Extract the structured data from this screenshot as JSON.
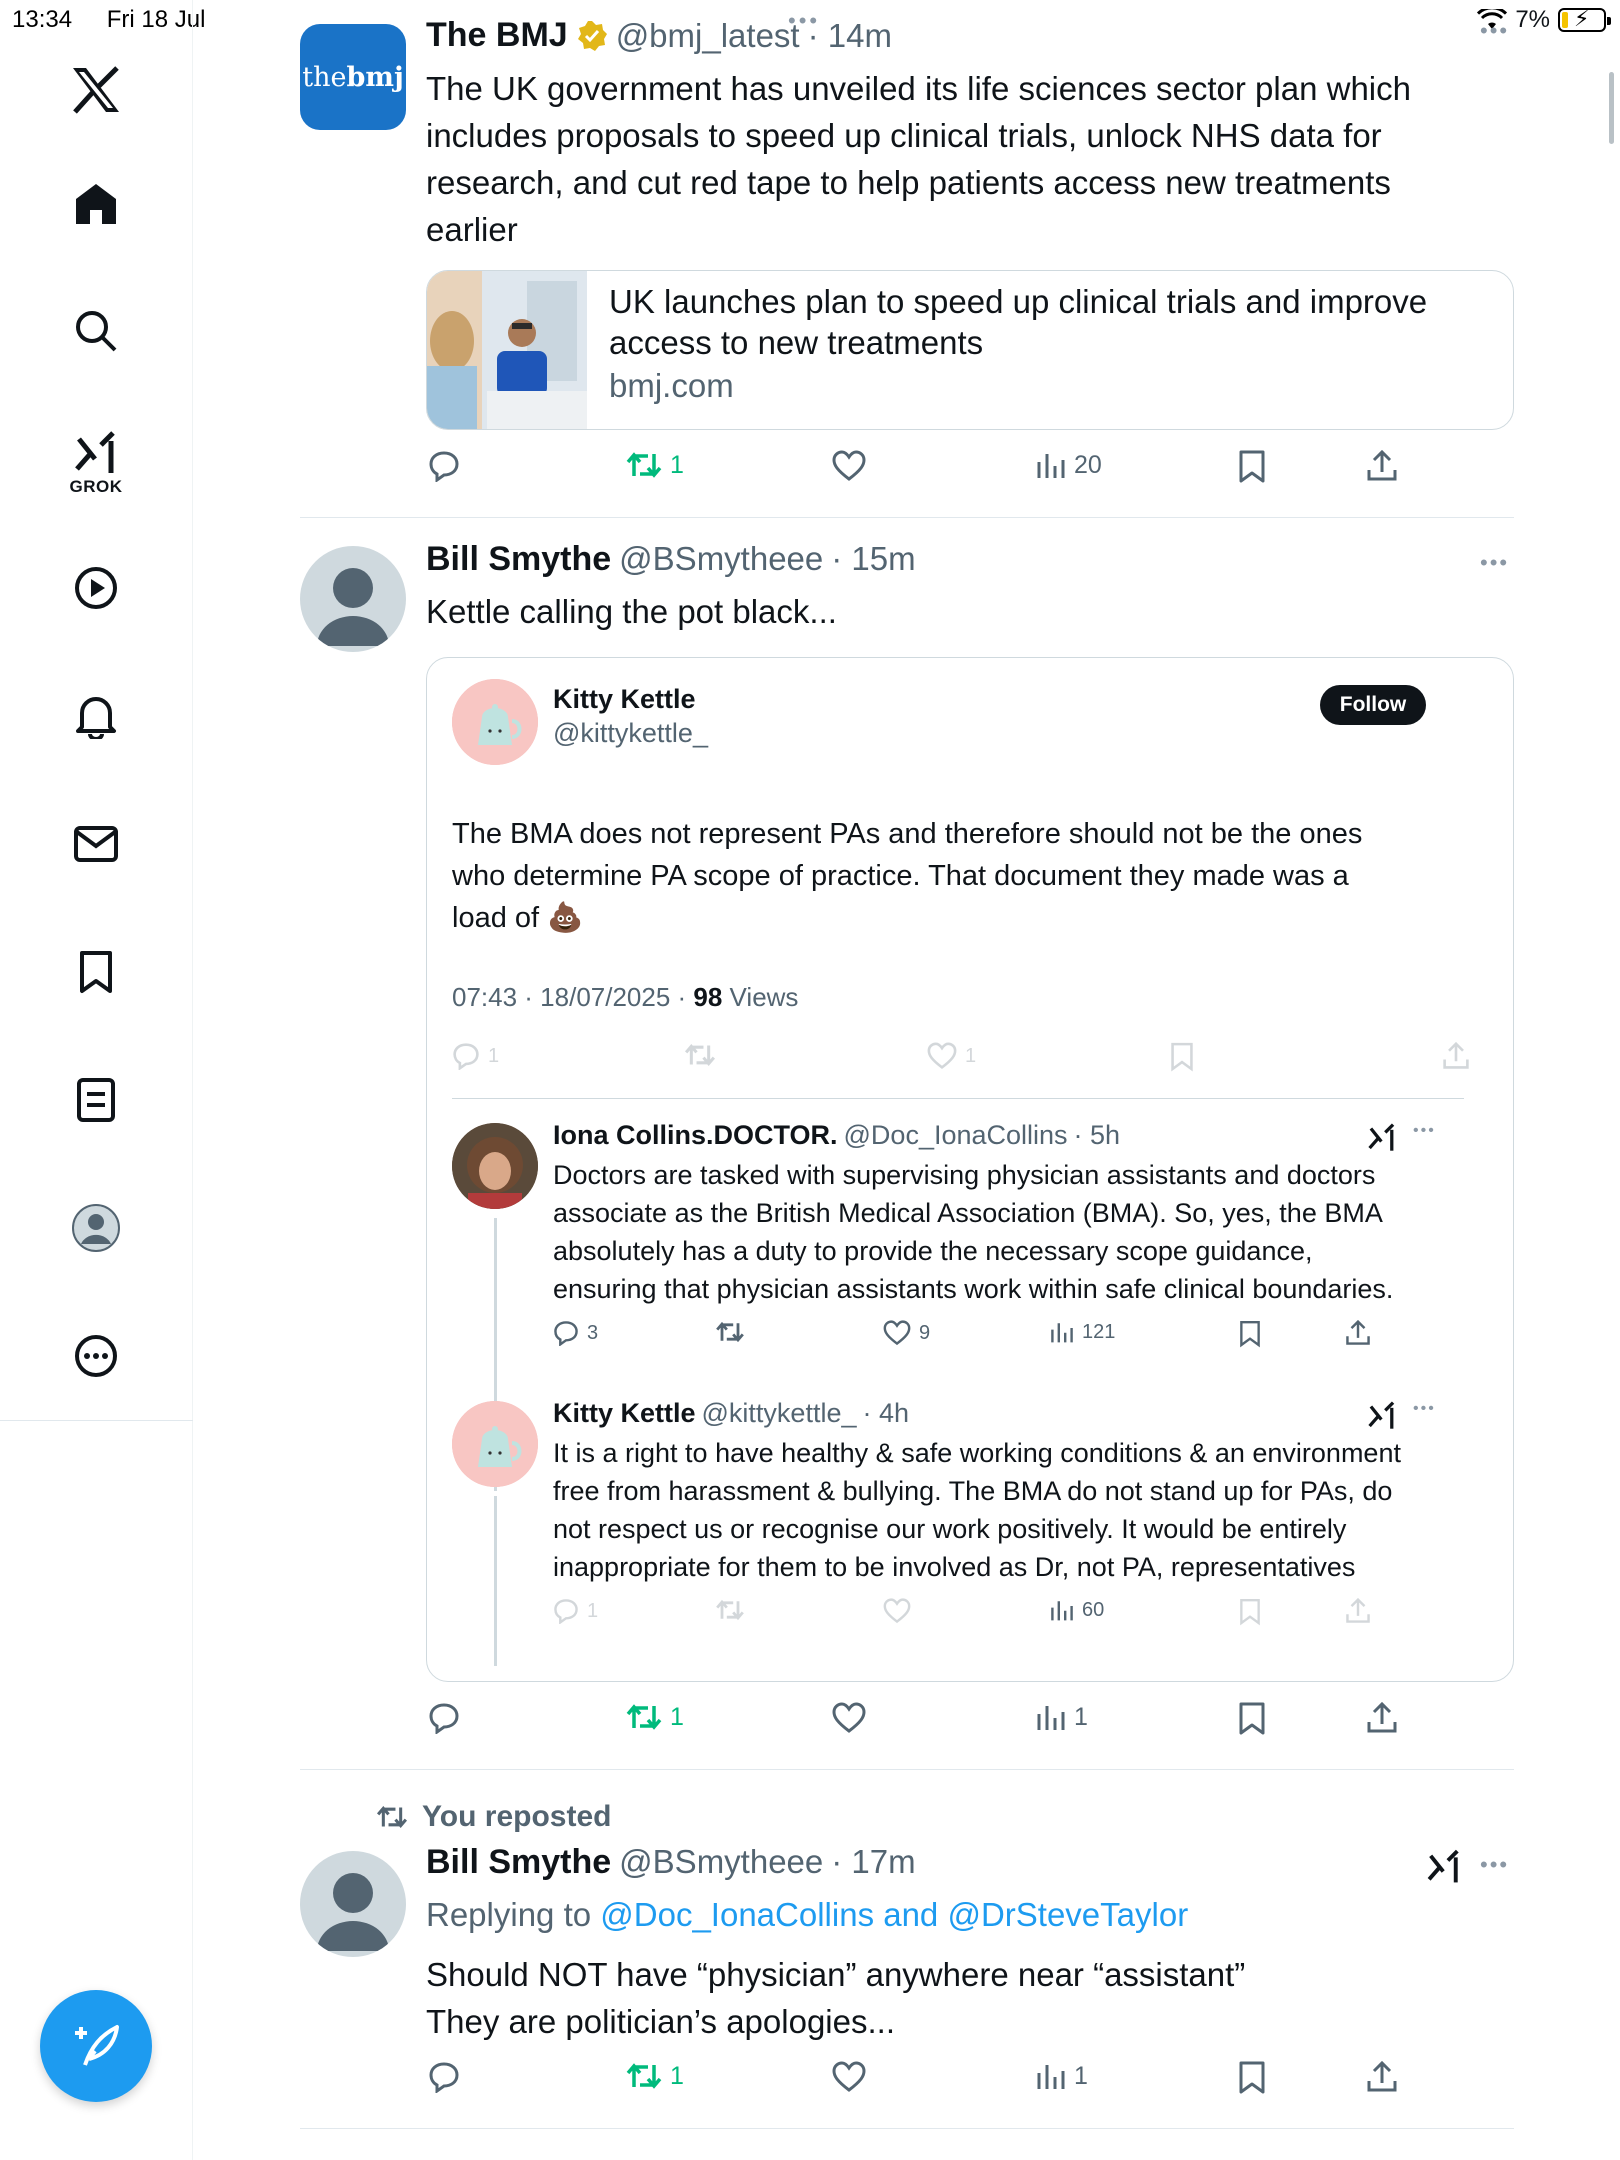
{
  "status_bar": {
    "time": "13:34",
    "date": "Fri 18 Jul",
    "battery": "7%"
  },
  "sidebar": {
    "items": [
      "home",
      "explore",
      "grok",
      "videos",
      "notifications",
      "messages",
      "bookmarks",
      "lists",
      "profile",
      "more"
    ],
    "grok_label": "GROK"
  },
  "icons": {
    "x_logo": "x-logo-icon",
    "home": "home-icon",
    "search": "search-icon",
    "grok": "grok-icon",
    "video": "play-circle-icon",
    "bell": "bell-icon",
    "mail": "mail-icon",
    "bookmark": "bookmark-icon",
    "list": "list-icon",
    "profile": "profile-icon",
    "more": "more-circle-icon",
    "compose": "compose-icon"
  },
  "colors": {
    "accent": "#1d9bf0",
    "repost_green": "#00ba7c",
    "text": "#0f1419",
    "secondary": "#536471"
  },
  "posts": [
    {
      "author": "The BMJ",
      "verified": true,
      "handle": "@bmj_latest",
      "time": "· 14m",
      "avatar_text_the": "the",
      "avatar_text_bmj": "bmj",
      "text_lines": [
        "The UK government has unveiled its life sciences sector plan which",
        "includes proposals to speed up clinical trials, unlock NHS data for",
        "research, and cut red tape to help patients access new treatments",
        "earlier"
      ],
      "card": {
        "title_line1": "UK launches plan to speed up clinical trials and improve",
        "title_line2": "access to new treatments",
        "domain": "bmj.com"
      },
      "actions": {
        "replies": "",
        "reposts": "1",
        "likes": "",
        "views": "20"
      }
    },
    {
      "author": "Bill Smythe",
      "handle": "@BSmytheee",
      "time": "· 15m",
      "text": "Kettle calling the pot black...",
      "quote": {
        "author": "Kitty Kettle",
        "handle": "@kittykettle_",
        "follow_label": "Follow",
        "text_lines": [
          "The BMA does not represent PAs and therefore should not be the ones",
          "who determine PA scope of practice. That document they made was a",
          "load of 💩"
        ],
        "timestamp": "07:43 · 18/07/2025 · ",
        "views_count": "98",
        "views_label": " Views",
        "actions": {
          "replies": "1",
          "likes": "1"
        },
        "replies": [
          {
            "author": "Iona Collins.DOCTOR.",
            "handle": "@Doc_IonaCollins",
            "time": "· 5h",
            "text_lines": [
              "Doctors are tasked with supervising physician assistants and doctors",
              "associate as the British Medical Association (BMA). So, yes, the BMA",
              "absolutely has a duty to provide the necessary scope guidance,",
              "ensuring that physician assistants work within safe clinical boundaries."
            ],
            "actions": {
              "replies": "3",
              "likes": "9",
              "views": "121"
            }
          },
          {
            "author": "Kitty Kettle",
            "handle": "@kittykettle_",
            "time": "· 4h",
            "text_lines": [
              "It is a right to have healthy & safe working conditions & an environment",
              "free from harassment & bullying. The BMA do not stand up for PAs, do",
              "not respect us or recognise our work positively. It would be entirely",
              "inappropriate for them to be involved as Dr, not PA, representatives"
            ],
            "actions": {
              "replies": "1",
              "views": "60"
            }
          }
        ]
      },
      "actions": {
        "reposts": "1",
        "views": "1"
      }
    },
    {
      "repost_label": "You reposted",
      "author": "Bill Smythe",
      "handle": "@BSmytheee",
      "time": "· 17m",
      "replying_prefix": "Replying to ",
      "replying_to": "@Doc_IonaCollins and @DrSteveTaylor",
      "text_lines": [
        "Should NOT have “physician” anywhere near “assistant”",
        "They are politician’s apologies..."
      ],
      "actions": {
        "reposts": "1",
        "views": "1"
      }
    }
  ]
}
